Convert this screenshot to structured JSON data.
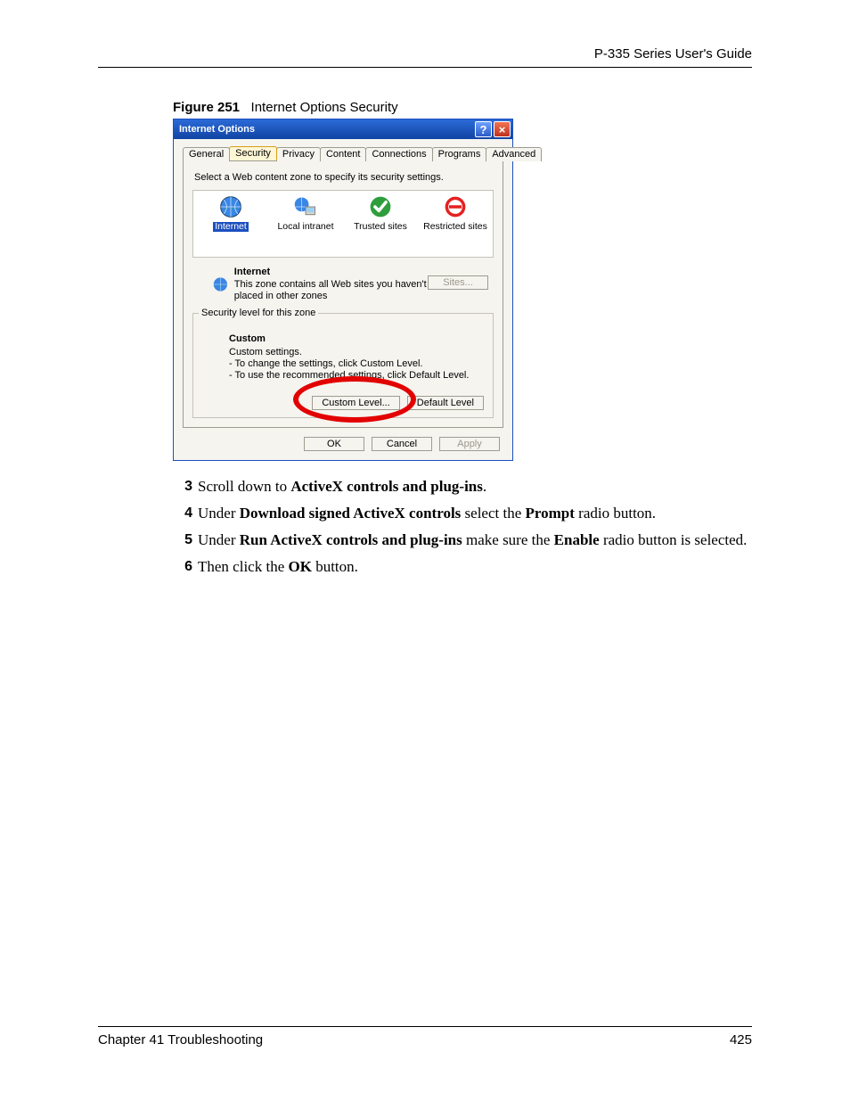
{
  "doc": {
    "header": "P-335 Series User's Guide",
    "figure_num": "Figure 251",
    "figure_title": "Internet Options Security",
    "footer_left": "Chapter 41 Troubleshooting",
    "footer_right": "425"
  },
  "dialog": {
    "title": "Internet Options",
    "tabs": [
      "General",
      "Security",
      "Privacy",
      "Content",
      "Connections",
      "Programs",
      "Advanced"
    ],
    "active_tab_index": 1,
    "zone_instruction": "Select a Web content zone to specify its security settings.",
    "zones": [
      {
        "name": "Internet",
        "selected": true
      },
      {
        "name": "Local intranet",
        "selected": false
      },
      {
        "name": "Trusted sites",
        "selected": false
      },
      {
        "name": "Restricted sites",
        "selected": false
      }
    ],
    "selected_zone_title": "Internet",
    "selected_zone_desc": "This zone contains all Web sites you haven't placed in other zones",
    "sites_button": "Sites...",
    "fieldset_legend": "Security level for this zone",
    "level_title": "Custom",
    "level_lines": [
      "Custom settings.",
      "- To change the settings, click Custom Level.",
      "- To use the recommended settings, click Default Level."
    ],
    "custom_btn": "Custom Level...",
    "default_btn": "Default Level",
    "ok": "OK",
    "cancel": "Cancel",
    "apply": "Apply"
  },
  "steps": [
    {
      "n": "3",
      "parts": [
        "Scroll down to ",
        "<b>ActiveX controls and plug-ins</b>",
        "."
      ]
    },
    {
      "n": "4",
      "parts": [
        "Under ",
        "<b>Download signed ActiveX controls</b>",
        " select the ",
        "<b>Prompt</b>",
        " radio button."
      ]
    },
    {
      "n": "5",
      "parts": [
        "Under ",
        "<b>Run ActiveX controls and plug-ins</b>",
        " make sure the ",
        "<b>Enable</b>",
        " radio button is selected."
      ]
    },
    {
      "n": "6",
      "parts": [
        "Then click the ",
        "<b>OK</b>",
        " button."
      ]
    }
  ]
}
